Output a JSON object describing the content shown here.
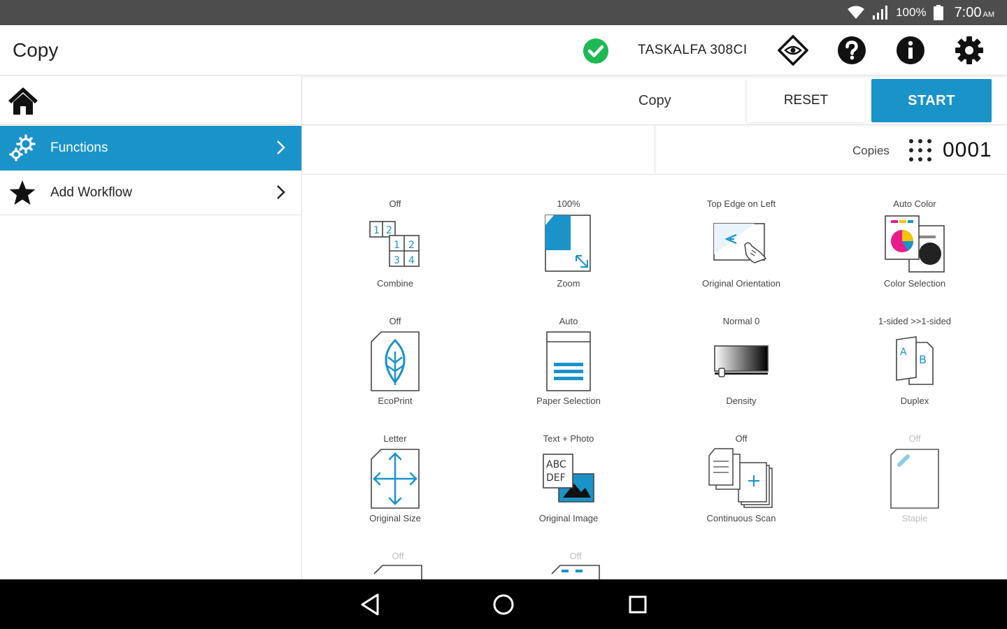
{
  "status_bar": {
    "battery": "100%",
    "time": "7:00",
    "ampm": "AM"
  },
  "app_bar": {
    "title": "Copy",
    "device": "TASKALFA 308CI",
    "icons": [
      "check-circle-icon",
      "eye-diamond-icon",
      "help-icon",
      "info-icon",
      "settings-gear-icon"
    ]
  },
  "sidebar": {
    "home_icon": "home-icon",
    "items": [
      {
        "label": "Functions",
        "icon": "gears-icon",
        "active": true
      },
      {
        "label": "Add Workflow",
        "icon": "star-icon",
        "active": false
      }
    ]
  },
  "toolbar": {
    "mode": "Copy",
    "reset_label": "RESET",
    "start_label": "START"
  },
  "copies": {
    "label": "Copies",
    "value": "0001"
  },
  "functions": [
    {
      "value": "Off",
      "label": "Combine",
      "icon": "combine-icon"
    },
    {
      "value": "100%",
      "label": "Zoom",
      "icon": "zoom-icon"
    },
    {
      "value": "Top Edge on Left",
      "label": "Original Orientation",
      "icon": "orientation-icon"
    },
    {
      "value": "Auto Color",
      "label": "Color Selection",
      "icon": "color-selection-icon"
    },
    {
      "value": "Off",
      "label": "EcoPrint",
      "icon": "ecoprint-leaf-icon"
    },
    {
      "value": "Auto",
      "label": "Paper Selection",
      "icon": "paper-tray-icon"
    },
    {
      "value": "Normal 0",
      "label": "Density",
      "icon": "density-gradient-icon"
    },
    {
      "value": "1-sided >>1-sided",
      "label": "Duplex",
      "icon": "duplex-icon"
    },
    {
      "value": "Letter",
      "label": "Original Size",
      "icon": "original-size-arrows-icon"
    },
    {
      "value": "Text + Photo",
      "label": "Original Image",
      "icon": "original-image-icon"
    },
    {
      "value": "Off",
      "label": "Continuous Scan",
      "icon": "continuous-scan-icon"
    },
    {
      "value": "Off",
      "label": "Staple",
      "icon": "staple-icon",
      "disabled": true
    },
    {
      "value": "Off",
      "label": "",
      "icon": "partial-icon"
    },
    {
      "value": "Off",
      "label": "",
      "icon": "partial-icon"
    }
  ],
  "colors": {
    "accent": "#1a93c9",
    "ok_green": "#1db954",
    "status_bar": "#4d4d4d"
  }
}
